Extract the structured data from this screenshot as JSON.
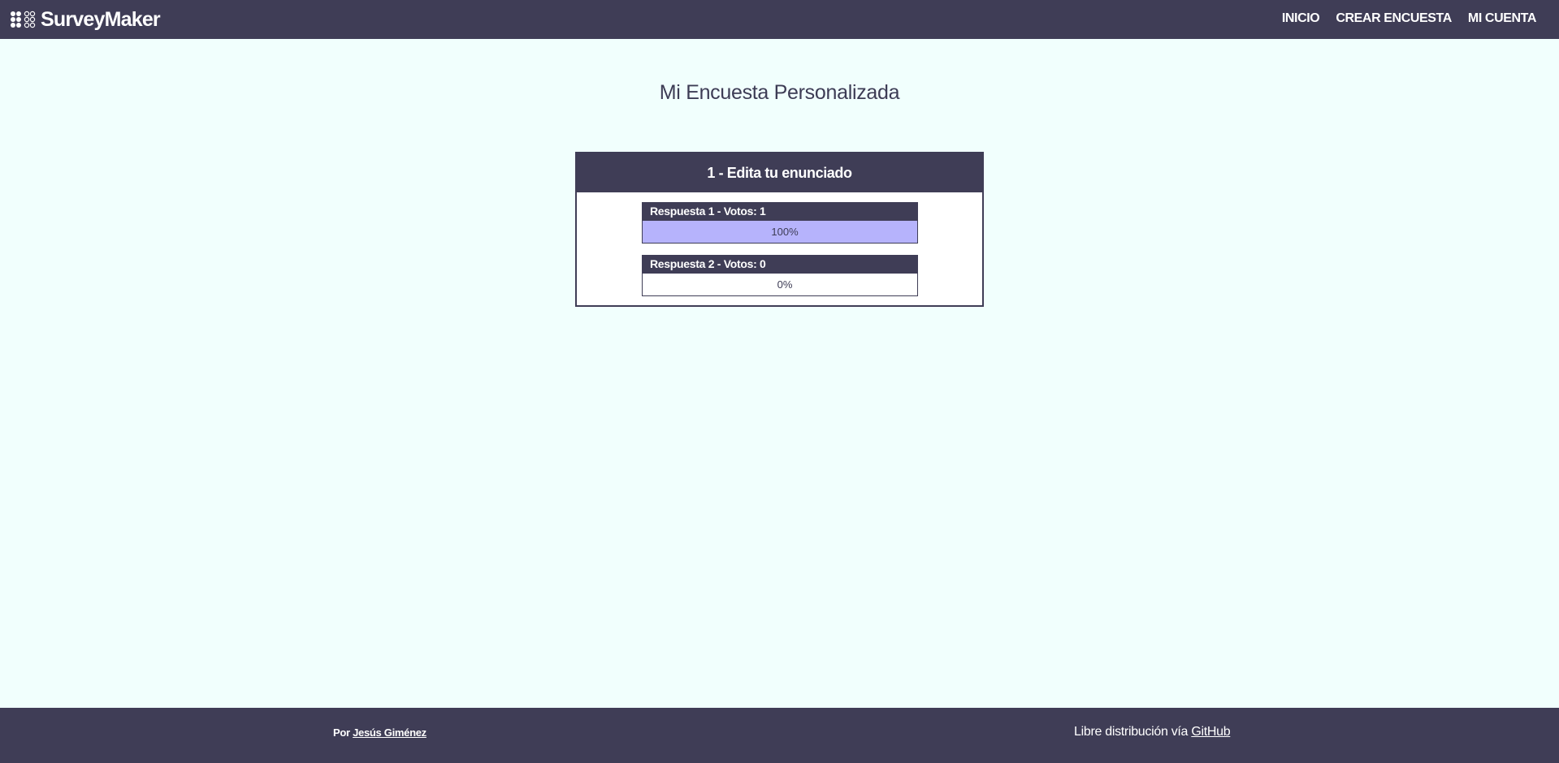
{
  "brand": {
    "name": "SurveyMaker",
    "icon": "dots-grid-icon"
  },
  "nav": {
    "items": [
      "INICIO",
      "CREAR ENCUESTA",
      "MI CUENTA"
    ]
  },
  "page": {
    "title": "Mi Encuesta Personalizada"
  },
  "question": {
    "title": "1 - Edita tu enunciado",
    "answers": [
      {
        "label": "Respuesta 1 - Votos: 1",
        "percent_text": "100%",
        "fill_percent": 100
      },
      {
        "label": "Respuesta 2 - Votos: 0",
        "percent_text": "0%",
        "fill_percent": 0
      }
    ]
  },
  "footer": {
    "author_prefix": "Por",
    "author_name": "Jesús Giménez",
    "license_text": "Libre distribución vía",
    "license_link": "GitHub"
  },
  "colors": {
    "header_bg": "#3f3d56",
    "page_bg": "#f1fffd",
    "bar_fill": "#b6b3fc"
  }
}
